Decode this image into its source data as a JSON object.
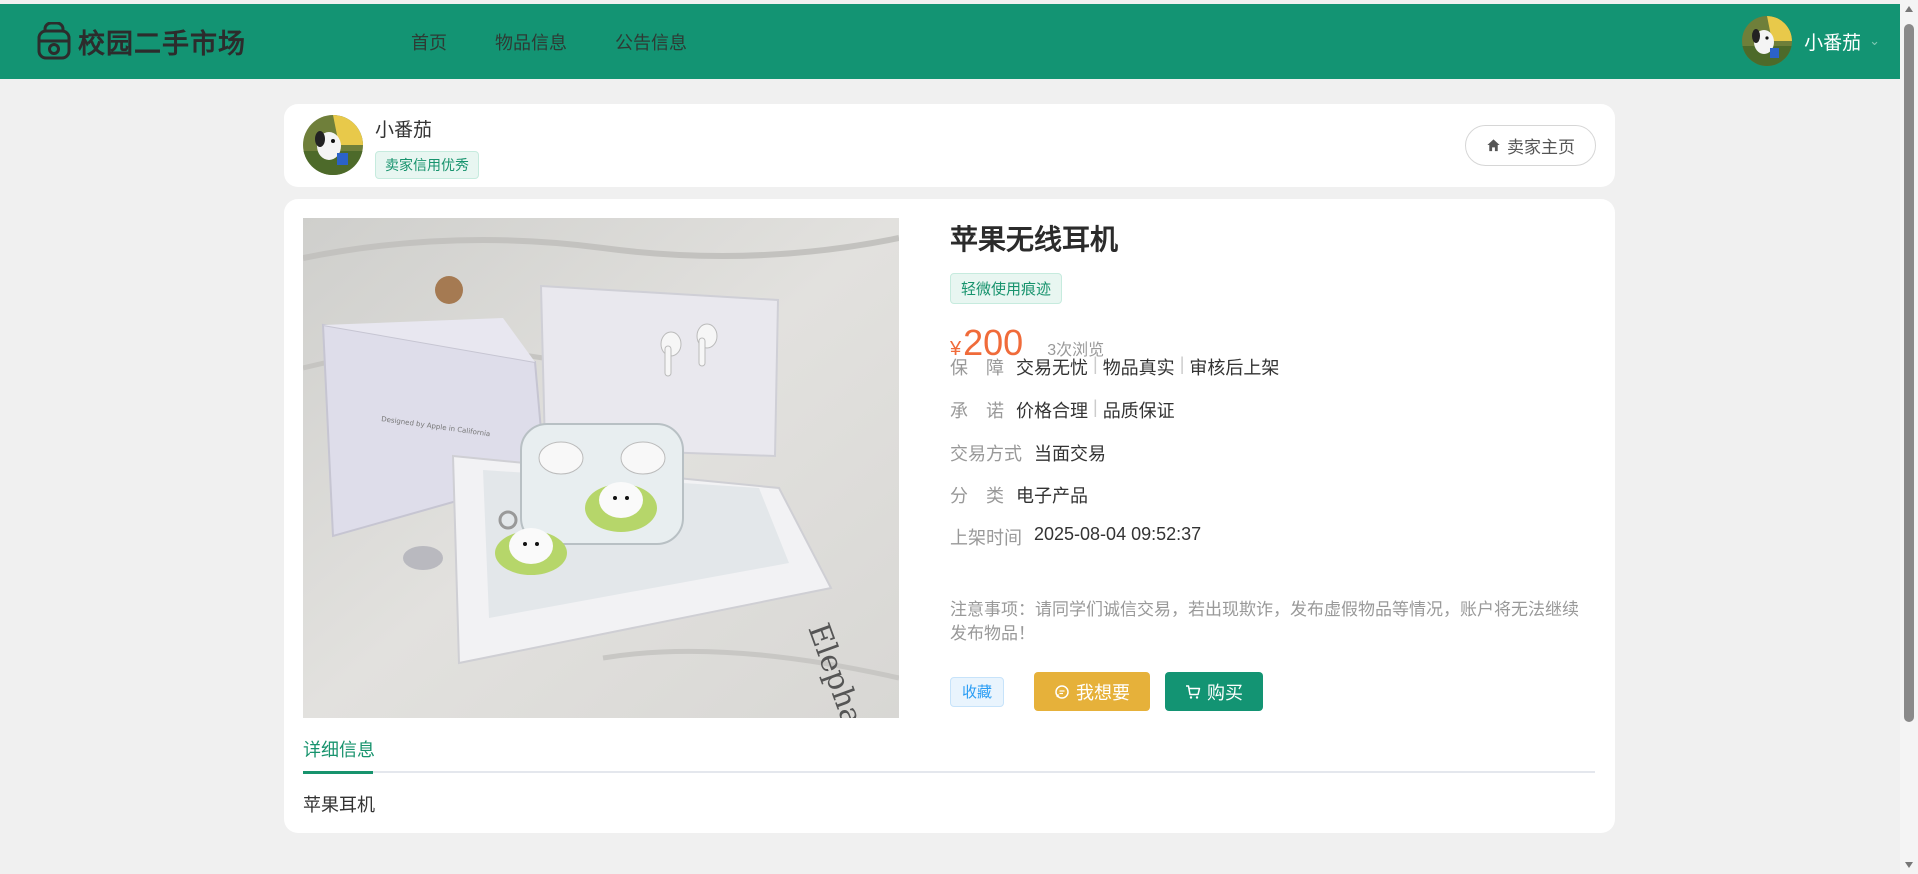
{
  "app": {
    "logo_text": "校园二手市场"
  },
  "nav": {
    "items": [
      {
        "label": "首页"
      },
      {
        "label": "物品信息"
      },
      {
        "label": "公告信息"
      }
    ]
  },
  "user": {
    "name": "小番茄"
  },
  "seller": {
    "name": "小番茄",
    "credit_tag": "卖家信用优秀",
    "home_button": "卖家主页"
  },
  "item": {
    "title": "苹果无线耳机",
    "condition_tag": "轻微使用痕迹",
    "currency": "¥",
    "price": "200",
    "views": "3次浏览",
    "guarantee_label": "保　障",
    "guarantee_values": [
      "交易无忧",
      "物品真实",
      "审核后上架"
    ],
    "promise_label": "承　诺",
    "promise_values": [
      "价格合理",
      "品质保证"
    ],
    "trade_label": "交易方式",
    "trade_value": "当面交易",
    "category_label": "分　类",
    "category_value": "电子产品",
    "listed_label": "上架时间",
    "listed_value": "2025-08-04 09:52:37",
    "note": "注意事项：请同学们诚信交易，若出现欺诈，发布虚假物品等情况，账户将无法继续发布物品！"
  },
  "actions": {
    "favorite": "收藏",
    "want": "我想要",
    "buy": "购买"
  },
  "tabs": {
    "detail": "详细信息"
  },
  "detail": {
    "text": "苹果耳机"
  },
  "colors": {
    "brand": "#139473",
    "price": "#f06b3a",
    "want": "#e6b13a"
  }
}
